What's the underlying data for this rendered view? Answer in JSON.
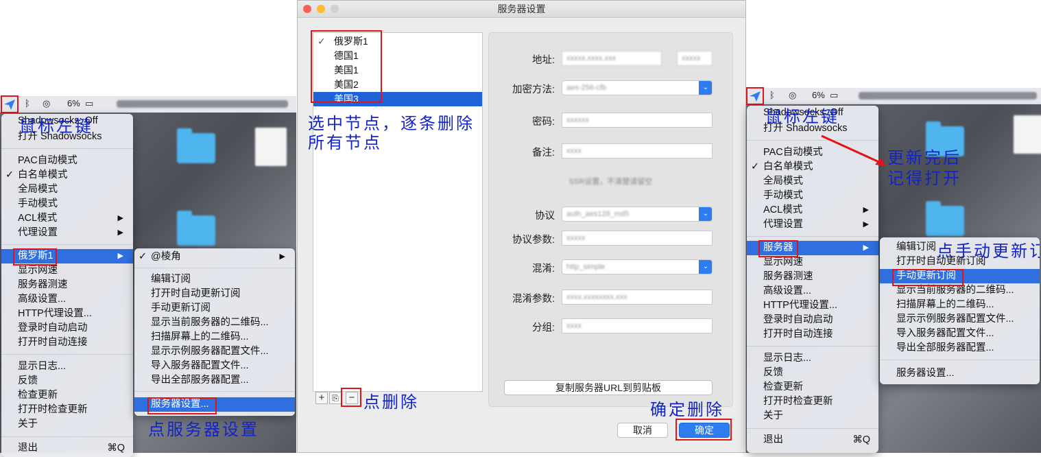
{
  "colors": {
    "annotation": "#1224c8",
    "highlight_box": "#e2141a",
    "selection": "#2f6fe0",
    "confirm_button": "#2d7df0"
  },
  "left": {
    "status": {
      "battery": "6%",
      "icons": [
        "paper-plane-icon",
        "bluetooth-icon",
        "wifi-icon",
        "battery-icon"
      ]
    },
    "menu_items": [
      {
        "label": "Shadowsocks: Off"
      },
      {
        "label": "打开 Shadowsocks"
      },
      {
        "label": "PAC自动模式"
      },
      {
        "label": "白名单模式",
        "checked": "✓"
      },
      {
        "label": "全局模式"
      },
      {
        "label": "手动模式"
      },
      {
        "label": "ACL模式",
        "arrow": "▶"
      },
      {
        "label": "代理设置",
        "arrow": "▶"
      },
      {
        "label": "俄罗斯1",
        "arrow": "▶"
      },
      {
        "label": "显示网速"
      },
      {
        "label": "服务器测速"
      },
      {
        "label": "高级设置..."
      },
      {
        "label": "HTTP代理设置..."
      },
      {
        "label": "登录时自动启动"
      },
      {
        "label": "打开时自动连接"
      },
      {
        "label": "显示日志..."
      },
      {
        "label": "反馈"
      },
      {
        "label": "检查更新"
      },
      {
        "label": "打开时检查更新"
      },
      {
        "label": "关于"
      },
      {
        "label": "退出",
        "shortcut": "⌘Q"
      }
    ],
    "submenu_items": [
      {
        "label": "@棱角",
        "checked": "✓",
        "arrow": "▶"
      },
      {
        "label": "编辑订阅"
      },
      {
        "label": "打开时自动更新订阅"
      },
      {
        "label": "手动更新订阅"
      },
      {
        "label": "显示当前服务器的二维码..."
      },
      {
        "label": "扫描屏幕上的二维码..."
      },
      {
        "label": "显示示例服务器配置文件..."
      },
      {
        "label": "导入服务器配置文件..."
      },
      {
        "label": "导出全部服务器配置..."
      },
      {
        "label": "服务器设置..."
      }
    ],
    "annotations": {
      "left_click": "鼠标左键",
      "server_settings": "点服务器设置"
    }
  },
  "dialog": {
    "title": "服务器设置",
    "servers": [
      {
        "name": "俄罗斯1",
        "checked": "✓"
      },
      {
        "name": "德国1"
      },
      {
        "name": "美国1"
      },
      {
        "name": "美国2"
      },
      {
        "name": "美国3"
      }
    ],
    "fields": [
      {
        "label": "地址:",
        "value": "xxxxx.xxxx.xxx",
        "port": "xxxxx"
      },
      {
        "label": "加密方法:",
        "value": "aes-256-cfb"
      },
      {
        "label": "密码:",
        "value": "xxxxxx"
      },
      {
        "label": "备注:",
        "value": "xxxx"
      },
      {
        "label": "协议",
        "value": "auth_aes128_md5"
      },
      {
        "label": "协议参数:",
        "value": "xxxxx"
      },
      {
        "label": "混淆:",
        "value": "http_simple"
      },
      {
        "label": "混淆参数:",
        "value": "xxxx.xxxxxxxx.xxx"
      },
      {
        "label": "分组:",
        "value": "xxxx"
      }
    ],
    "section_note": "SSR设置，不清楚请留空",
    "copy_button": "复制服务器URL到剪贴板",
    "cancel_button": "取消",
    "ok_button": "确定",
    "toolbar": {
      "add": "+",
      "duplicate": "⎘",
      "remove": "−"
    },
    "annotations": {
      "select_delete": "选中节点，逐条删除",
      "all_nodes": "所有节点",
      "click_delete": "点删除",
      "confirm_delete": "确定删除"
    }
  },
  "right": {
    "status": {
      "battery": "6%"
    },
    "menu_items": [
      {
        "label": "Shadowsocks: Off"
      },
      {
        "label": "打开 Shadowsocks"
      },
      {
        "label": "PAC自动模式"
      },
      {
        "label": "白名单模式",
        "checked": "✓"
      },
      {
        "label": "全局模式"
      },
      {
        "label": "手动模式"
      },
      {
        "label": "ACL模式",
        "arrow": "▶"
      },
      {
        "label": "代理设置",
        "arrow": "▶"
      },
      {
        "label": "服务器",
        "arrow": "▶"
      },
      {
        "label": "显示网速"
      },
      {
        "label": "服务器测速"
      },
      {
        "label": "高级设置..."
      },
      {
        "label": "HTTP代理设置..."
      },
      {
        "label": "登录时自动启动"
      },
      {
        "label": "打开时自动连接"
      },
      {
        "label": "显示日志..."
      },
      {
        "label": "反馈"
      },
      {
        "label": "检查更新"
      },
      {
        "label": "打开时检查更新"
      },
      {
        "label": "关于"
      },
      {
        "label": "退出",
        "shortcut": "⌘Q"
      }
    ],
    "submenu_items": [
      {
        "label": "编辑订阅"
      },
      {
        "label": "打开时自动更新订阅"
      },
      {
        "label": "手动更新订阅"
      },
      {
        "label": "显示当前服务器的二维码..."
      },
      {
        "label": "扫描屏幕上的二维码..."
      },
      {
        "label": "显示示例服务器配置文件..."
      },
      {
        "label": "导入服务器配置文件..."
      },
      {
        "label": "导出全部服务器配置..."
      },
      {
        "label": "服务器设置..."
      }
    ],
    "annotations": {
      "left_click": "鼠标左键",
      "reopen_1": "更新完后",
      "reopen_2": "记得打开",
      "manual_update": "点手动更新订阅"
    }
  }
}
